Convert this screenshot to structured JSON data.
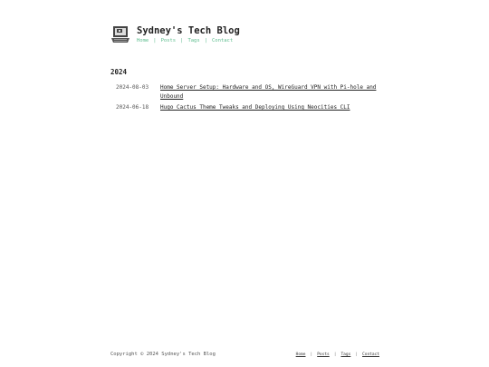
{
  "site": {
    "title": "Sydney's Tech Blog",
    "logo_icon": "computer-icon"
  },
  "nav": {
    "items": [
      {
        "label": "Home"
      },
      {
        "label": "Posts"
      },
      {
        "label": "Tags"
      },
      {
        "label": "Contact"
      }
    ],
    "separator": "|"
  },
  "archive": {
    "year": "2024",
    "posts": [
      {
        "date": "2024-08-03",
        "title": "Home Server Setup: Hardware and OS, WireGuard VPN with Pi-hole and Unbound"
      },
      {
        "date": "2024-06-18",
        "title": "Hugo Cactus Theme Tweaks and Deploying Using Neocities CLI"
      }
    ]
  },
  "footer": {
    "copyright": "Copyright © 2024 Sydney's Tech Blog",
    "nav": [
      {
        "label": "Home"
      },
      {
        "label": "Posts"
      },
      {
        "label": "Tags"
      },
      {
        "label": "Contact"
      }
    ],
    "separator": "|"
  },
  "colors": {
    "accent": "#5dbd8e",
    "text": "#222222"
  }
}
